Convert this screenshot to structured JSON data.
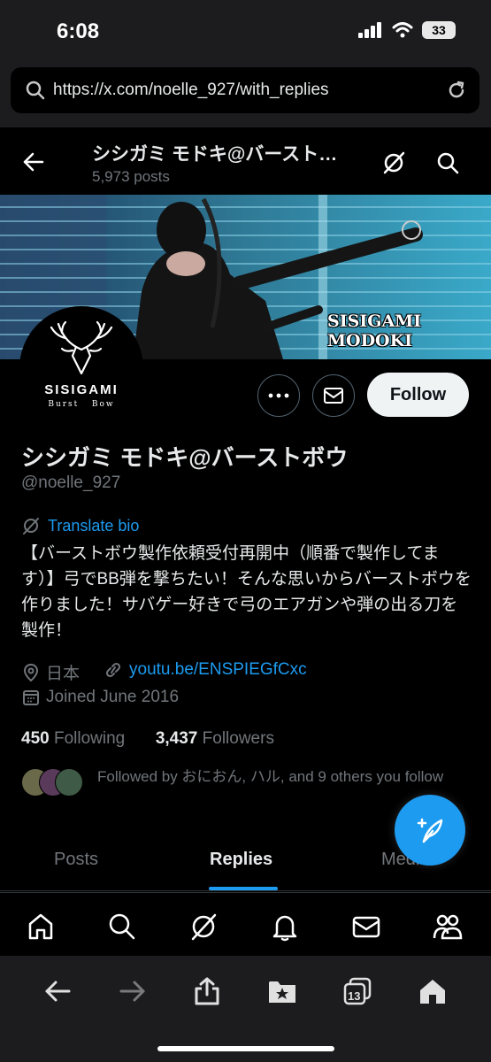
{
  "status_bar": {
    "time": "6:08",
    "battery": "33"
  },
  "browser": {
    "url": "https://x.com/noelle_927/with_replies"
  },
  "header": {
    "name": "シシガミ モドキ@バースト…",
    "posts": "5,973 posts"
  },
  "banner": {
    "line1": "SISIGAMI",
    "line2": "MODOKI"
  },
  "avatar": {
    "title": "SISIGAMI",
    "subtitle_left": "Burst",
    "subtitle_right": "Bow"
  },
  "profile": {
    "follow_label": "Follow",
    "display_name": "シシガミ モドキ@バーストボウ",
    "handle": "@noelle_927",
    "translate_label": "Translate bio",
    "bio": "【バーストボウ製作依頼受付再開中（順番で製作してます）】弓でBB弾を撃ちたい！そんな思いからバーストボウを作りました！サバゲー好きで弓のエアガンや弾の出る刀を製作！",
    "location": "日本",
    "website": "youtu.be/ENSPIEGfCxc",
    "joined": "Joined June 2016",
    "following_count": "450",
    "following_label": "Following",
    "followers_count": "3,437",
    "followers_label": "Followers",
    "followed_by": "Followed by おにおん, ハル, and 9 others you follow"
  },
  "tabs": [
    {
      "label": "Posts"
    },
    {
      "label": "Replies"
    },
    {
      "label": "Media"
    }
  ],
  "safari": {
    "tab_count": "13"
  },
  "colors": {
    "accent": "#1d9bf0",
    "background": "#000000",
    "muted": "#71767b"
  }
}
